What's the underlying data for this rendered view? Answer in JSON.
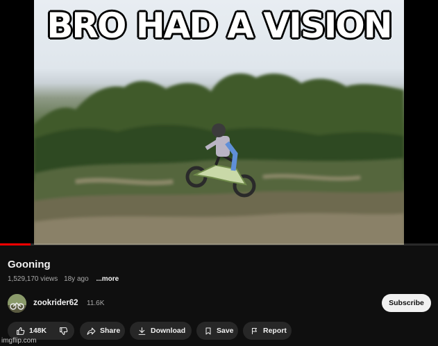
{
  "meme": {
    "caption": "BRO HAD A VISION"
  },
  "player": {
    "progress_fraction": 0.07
  },
  "video": {
    "title": "Gooning",
    "views": "1,529,170 views",
    "age": "18y ago",
    "more_label": "...more"
  },
  "channel": {
    "name": "zookrider62",
    "subscribers": "11.6K",
    "subscribe_label": "Subscribe"
  },
  "actions": {
    "like_count": "148K",
    "share_label": "Share",
    "download_label": "Download",
    "save_label": "Save",
    "report_label": "Report"
  },
  "watermark": "imgflip.com",
  "colors": {
    "background": "#0f0f0f",
    "chip": "#272727",
    "progress": "#ff0000",
    "subscribe": "#f1f1f1"
  },
  "icons": [
    "like-icon",
    "dislike-icon",
    "share-icon",
    "download-icon",
    "save-icon",
    "report-icon"
  ]
}
